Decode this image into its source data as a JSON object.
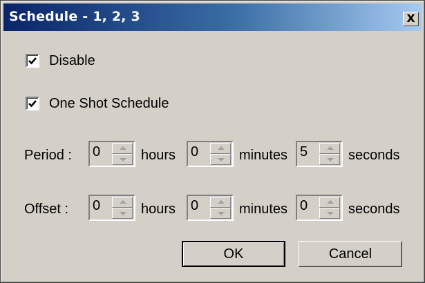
{
  "window": {
    "title": "Schedule - 1, 2, 3",
    "close_label": "X"
  },
  "options": {
    "disable": {
      "label": "Disable",
      "checked": true
    },
    "one_shot": {
      "label": "One Shot Schedule",
      "checked": true
    }
  },
  "period": {
    "label": "Period :",
    "hours": {
      "value": "0",
      "unit": "hours"
    },
    "minutes": {
      "value": "0",
      "unit": "minutes"
    },
    "seconds": {
      "value": "5",
      "unit": "seconds"
    }
  },
  "offset": {
    "label": "Offset :",
    "hours": {
      "value": "0",
      "unit": "hours"
    },
    "minutes": {
      "value": "0",
      "unit": "minutes"
    },
    "seconds": {
      "value": "0",
      "unit": "seconds"
    }
  },
  "buttons": {
    "ok": "OK",
    "cancel": "Cancel"
  }
}
